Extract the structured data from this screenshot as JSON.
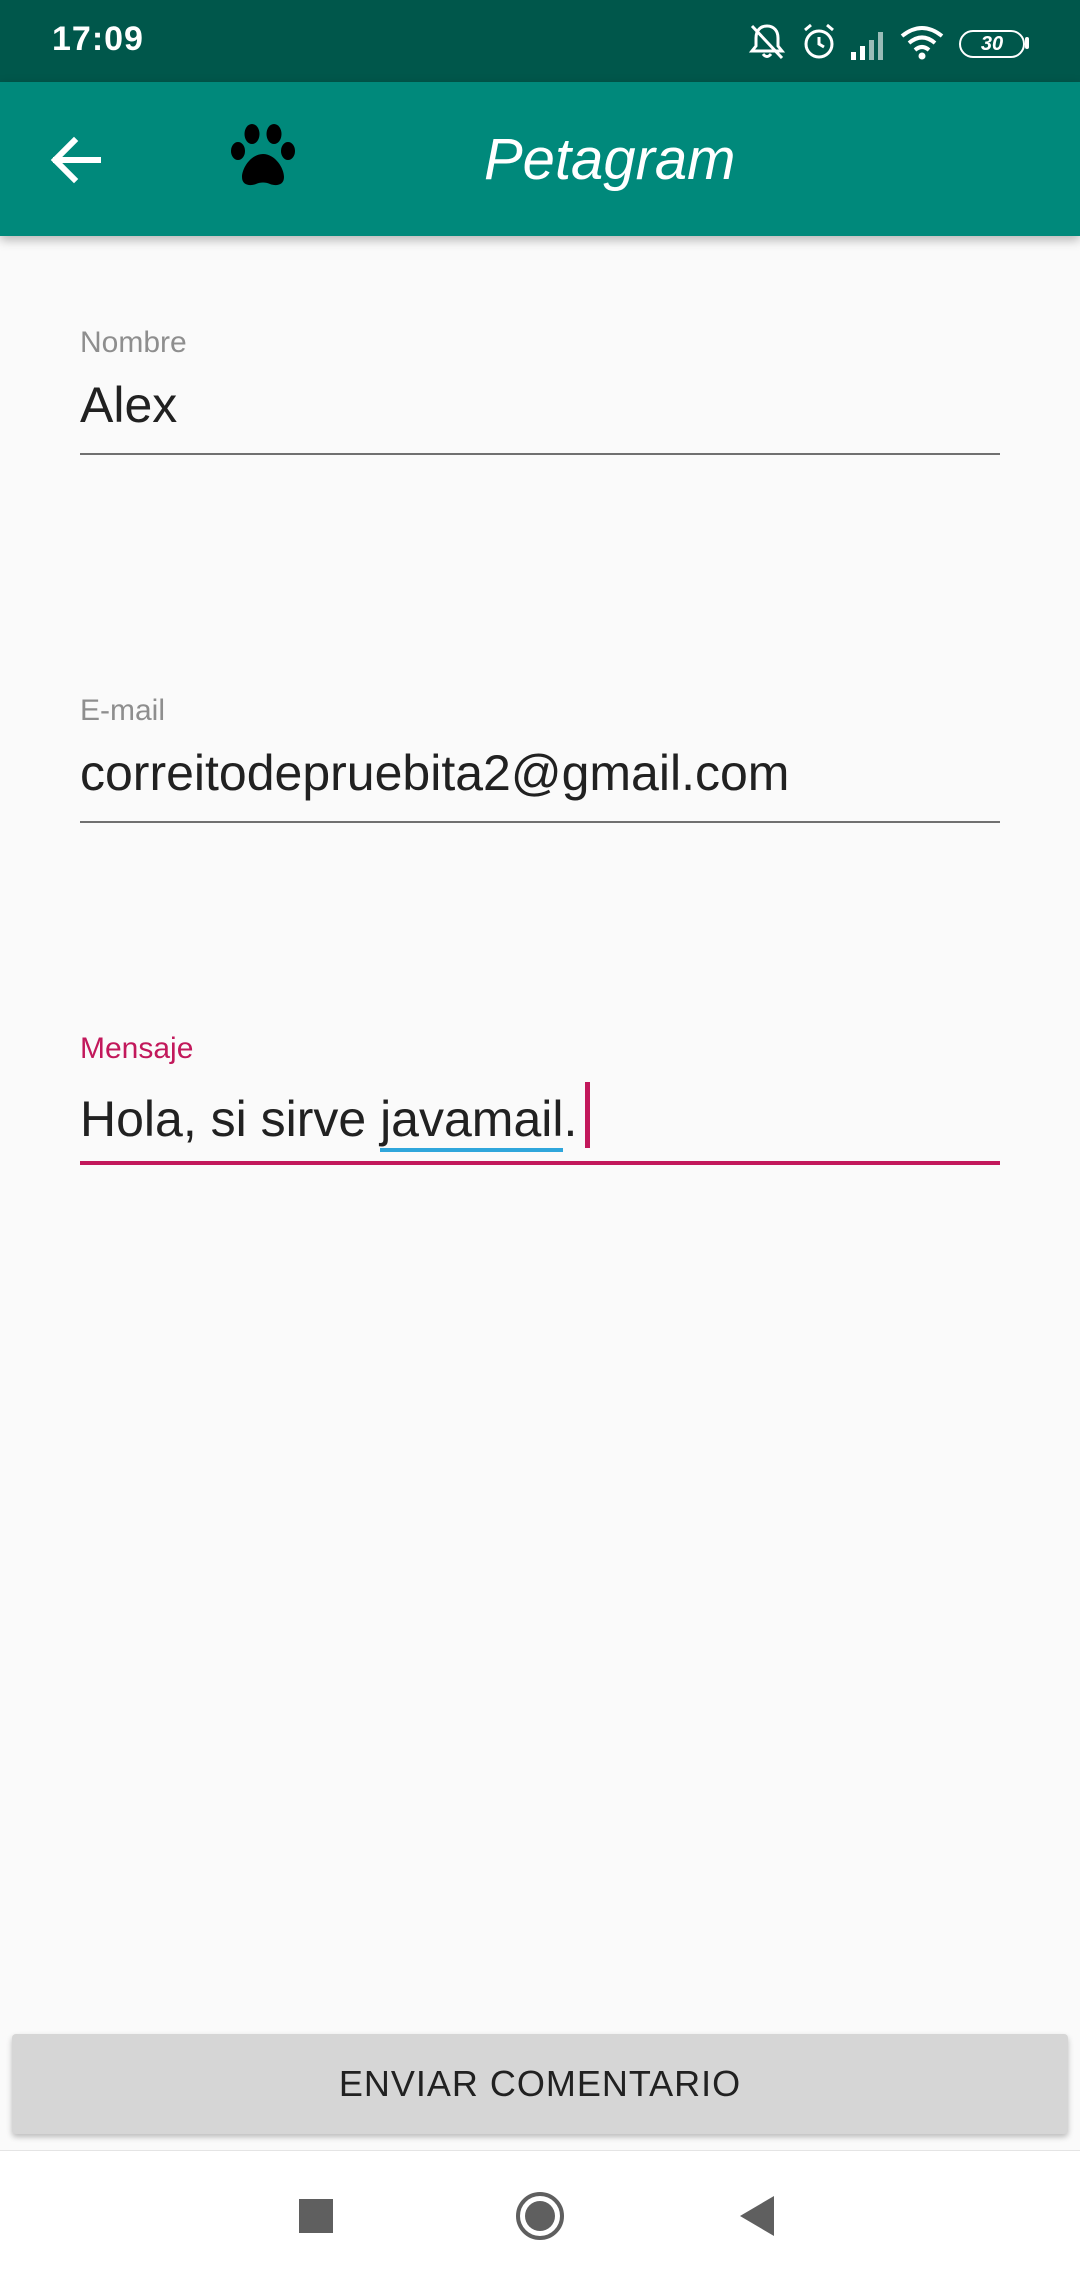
{
  "status_bar": {
    "time": "17:09",
    "battery": "30",
    "icons": [
      "notifications-off-icon",
      "alarm-icon",
      "signal-icon",
      "wifi-icon",
      "battery-icon"
    ]
  },
  "app_bar": {
    "title": "Petagram",
    "back_icon": "arrow-back-icon",
    "logo_icon": "paw-icon",
    "background": "#00897b",
    "status_background": "#00574b"
  },
  "form": {
    "nombre": {
      "label": "Nombre",
      "value": "Alex"
    },
    "email": {
      "label": "E-mail",
      "value": "correitodepruebita2@gmail.com"
    },
    "mensaje": {
      "label": "Mensaje",
      "value_prefix": "Hola, si sirve ",
      "value_flagged": "javamail",
      "value_suffix": ".",
      "focused": true
    },
    "accent_color": "#c2185b",
    "spellcheck_color": "#2fa6db"
  },
  "submit": {
    "label": "ENVIAR COMENTARIO"
  },
  "nav_bar": {
    "recents_icon": "square-recents-icon",
    "home_icon": "circle-home-icon",
    "back_icon": "triangle-back-icon"
  }
}
